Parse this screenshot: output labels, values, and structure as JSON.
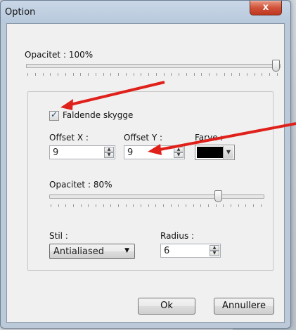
{
  "window": {
    "title": "Option",
    "close_label": "x"
  },
  "opacity": {
    "label": "Opacitet : 100%",
    "value_percent": 100
  },
  "shadow": {
    "checkbox_label": "Faldende skygge",
    "checked": true,
    "offset_x": {
      "label": "Offset X :",
      "value": "9"
    },
    "offset_y": {
      "label": "Offset Y :",
      "value": "9"
    },
    "color": {
      "label": "Farve :",
      "value": "#000000"
    },
    "opacity": {
      "label": "Opacitet : 80%",
      "value_percent": 80
    },
    "style": {
      "label": "Stil :",
      "value": "Antialiased"
    },
    "radius": {
      "label": "Radius :",
      "value": "6"
    }
  },
  "buttons": {
    "ok": "Ok",
    "cancel": "Annullere"
  },
  "annotation_color": "#e0201a"
}
